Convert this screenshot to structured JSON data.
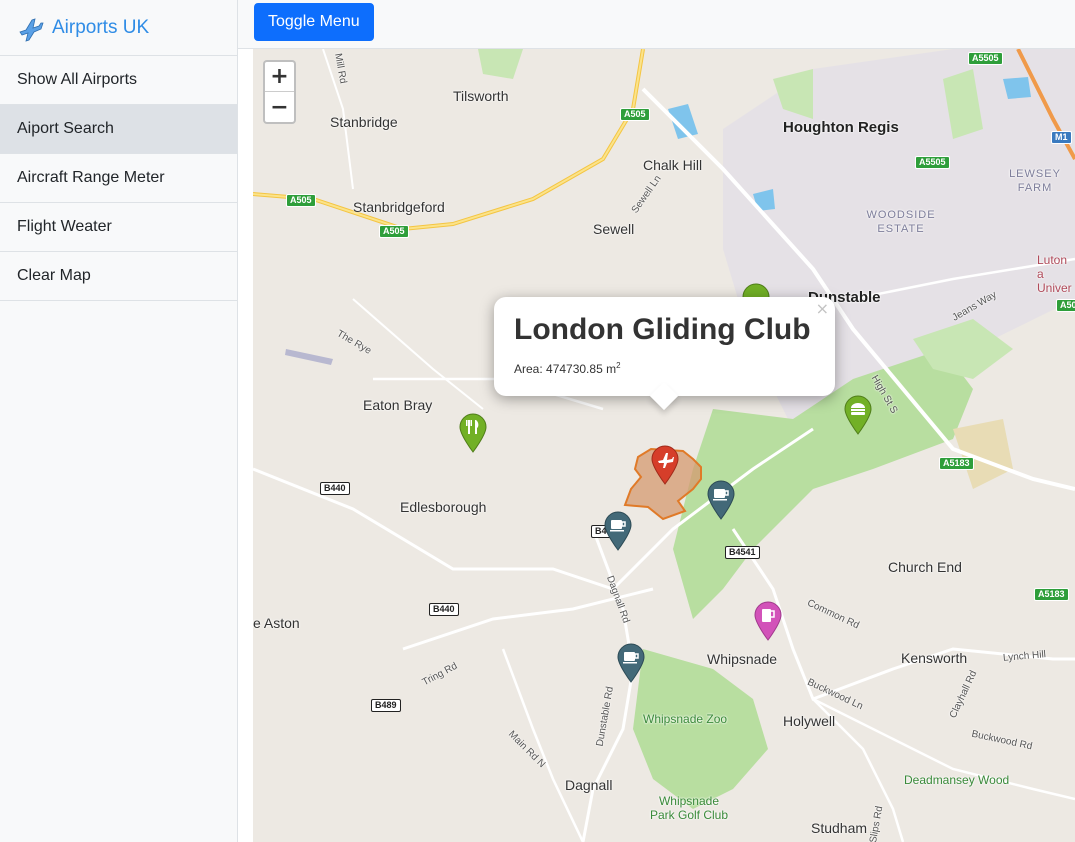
{
  "sidebar": {
    "brand": "Airports UK",
    "items": [
      {
        "label": "Show All Airports"
      },
      {
        "label": "Aiport Search"
      },
      {
        "label": "Aircraft Range Meter"
      },
      {
        "label": "Flight Weater"
      },
      {
        "label": "Clear Map"
      }
    ],
    "active_index": 1
  },
  "topbar": {
    "toggle_label": "Toggle Menu"
  },
  "map": {
    "zoom_in": "+",
    "zoom_out": "−",
    "places": {
      "tilsworth": "Tilsworth",
      "stanbridge": "Stanbridge",
      "houghton_regis": "Houghton Regis",
      "chalk_hill": "Chalk Hill",
      "stanbridgeford": "Stanbridgeford",
      "sewell": "Sewell",
      "dunstable": "Dunstable",
      "eaton_bray": "Eaton Bray",
      "edlesborough": "Edlesborough",
      "church_end": "Church End",
      "aston": "e Aston",
      "whipsnade": "Whipsnade",
      "kensworth": "Kensworth",
      "holywell": "Holywell",
      "dagnall": "Dagnall",
      "studham": "Studham",
      "luton": "Luton a Univer"
    },
    "areas": {
      "lewsey": "LEWSEY FARM",
      "woodside": "WOODSIDE ESTATE"
    },
    "green_labels": {
      "whipsnade_zoo": "Whipsnade Zoo",
      "golf": "Whipsnade Park Golf Club",
      "deadmansey": "Deadmansey Wood"
    },
    "roads": {
      "mill_rd": "Mill Rd",
      "sewell_ln": "Sewell Ln",
      "the_rye": "The Rye",
      "jeans_way": "Jeans Way",
      "high_st_s": "High St S",
      "dagnall_rd": "Dagnall Rd",
      "common_rd": "Common Rd",
      "lynch_hill": "Lynch Hill",
      "tring_rd": "Tring Rd",
      "dunstable_rd": "Dunstable Rd",
      "buckwood_ln": "Buckwood Ln",
      "clayhall_rd": "Clayhall Rd",
      "buckwood_rd": "Buckwood Rd",
      "main_rd_n": "Main Rd N",
      "slips_rd": "Slips Rd"
    },
    "shields": {
      "a5505_1": "A5505",
      "a505_1": "A505",
      "a505_2": "A505",
      "a505_3": "A505",
      "a5505_2": "A5505",
      "m1": "M1",
      "a5183_1": "A5183",
      "a5183_2": "A5183",
      "a50": "A50",
      "b440_1": "B440",
      "b440_2": "B440",
      "b4541": "B4541",
      "b489": "B489",
      "b4_partial": "B4"
    }
  },
  "popup": {
    "title": "London Gliding Club",
    "area_label": "Area: 474730.85 m",
    "area_unit_sup": "2",
    "close": "×"
  },
  "colors": {
    "brand": "#2f8ce6",
    "button": "#0d6efd",
    "map_bg": "#ede9e3",
    "park": "#b8dea0",
    "airfield": "#d49a70",
    "marker_red": "#d63e2a",
    "marker_green": "#72b026",
    "marker_slate": "#436978",
    "marker_pink": "#d252b9"
  },
  "markers": [
    {
      "type": "airport",
      "icon": "plane-icon",
      "color": "red"
    },
    {
      "type": "restaurant",
      "icon": "cutlery-icon",
      "color": "green"
    },
    {
      "type": "cafe",
      "icon": "coffee-icon",
      "color": "slate"
    },
    {
      "type": "cafe",
      "icon": "coffee-icon",
      "color": "slate"
    },
    {
      "type": "cafe",
      "icon": "coffee-icon",
      "color": "slate"
    },
    {
      "type": "pub",
      "icon": "beer-icon",
      "color": "pink"
    },
    {
      "type": "fast-food",
      "icon": "burger-icon",
      "color": "green"
    }
  ]
}
